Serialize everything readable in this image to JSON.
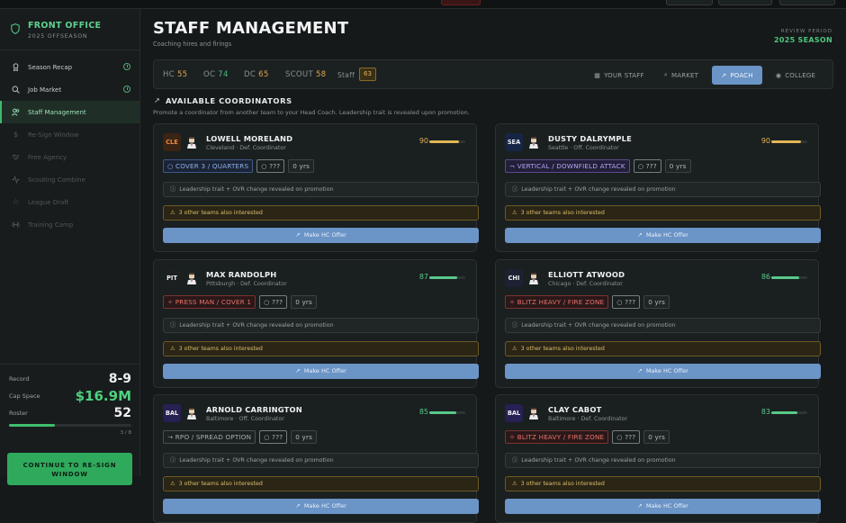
{
  "sidebar": {
    "title": "FRONT OFFICE",
    "subtitle": "2025 OFFSEASON",
    "items": [
      {
        "label": "Season Recap",
        "icon": "award-icon",
        "state": "done"
      },
      {
        "label": "Job Market",
        "icon": "search-icon",
        "state": "done"
      },
      {
        "label": "Staff Management",
        "icon": "users-icon",
        "state": "active"
      },
      {
        "label": "Re-Sign Window",
        "icon": "dollar-icon",
        "state": "locked"
      },
      {
        "label": "Free Agency",
        "icon": "handshake-icon",
        "state": "locked"
      },
      {
        "label": "Scouting Combine",
        "icon": "activity-icon",
        "state": "locked"
      },
      {
        "label": "League Draft",
        "icon": "star-icon",
        "state": "locked"
      },
      {
        "label": "Training Camp",
        "icon": "dumbbell-icon",
        "state": "locked"
      }
    ],
    "stats": {
      "record_label": "Record",
      "record": "8-9",
      "cap_label": "Cap Space",
      "cap": "$16.9M",
      "roster_label": "Roster",
      "roster": "52",
      "progress_text": "3 / 8",
      "progress_fraction": 0.375
    },
    "continue_label": "CONTINUE TO RE-SIGN WINDOW"
  },
  "header": {
    "title": "STAFF MANAGEMENT",
    "subtitle": "Coaching hires and firings",
    "review_label": "REVIEW PERIOD",
    "review_value": "2025 SEASON"
  },
  "counts": {
    "hc_label": "HC",
    "hc": "55",
    "oc_label": "OC",
    "oc": "74",
    "dc_label": "DC",
    "dc": "65",
    "scout_label": "SCOUT",
    "scout": "58",
    "staff_label": "Staff",
    "staff": "63"
  },
  "tabs": [
    {
      "label": "YOUR STAFF",
      "icon": "building-icon"
    },
    {
      "label": "MARKET",
      "icon": "search-icon"
    },
    {
      "label": "POACH",
      "icon": "arrow-up-right-icon",
      "active": true
    },
    {
      "label": "COLLEGE",
      "icon": "eye-icon"
    }
  ],
  "section": {
    "title": "AVAILABLE COORDINATORS",
    "subtitle": "Promote a coordinator from another team to your Head Coach. Leadership trait is revealed upon promotion."
  },
  "colors": {
    "accent_green": "#4fd07f",
    "accent_blue": "#6b94c7",
    "gold": "#e1b656"
  },
  "coordinators": [
    {
      "team": "CLE",
      "team_color": "#3a2414",
      "team_text": "#f08a3a",
      "name": "LOWELL MORELAND",
      "location": "Cleveland · Def. Coordinator",
      "ovr": "90",
      "ovr_value": 90,
      "ovr_color": "gold",
      "scheme": "COVER 3 / QUARTERS",
      "scheme_style": "blue",
      "scheme_icon": "○",
      "trait": "○ ???",
      "experience": "0 yrs",
      "leadership_note": "Leadership trait + OVR change revealed on promotion",
      "interest_note": "3 other teams also interested",
      "offer_label": "Make HC Offer"
    },
    {
      "team": "SEA",
      "team_color": "#172544",
      "team_text": "#eaf0f7",
      "name": "DUSTY DALRYMPLE",
      "location": "Seattle · Off. Coordinator",
      "ovr": "90",
      "ovr_value": 90,
      "ovr_color": "gold",
      "scheme": "VERTICAL / DOWNFIELD ATTACK",
      "scheme_style": "purple",
      "scheme_icon": "¬",
      "trait": "○ ???",
      "experience": "0 yrs",
      "leadership_note": "Leadership trait + OVR change revealed on promotion",
      "interest_note": "3 other teams also interested",
      "offer_label": "Make HC Offer"
    },
    {
      "team": "PIT",
      "team_color": "#1d2021",
      "team_text": "#f2f2f2",
      "name": "MAX RANDOLPH",
      "location": "Pittsburgh · Def. Coordinator",
      "ovr": "87",
      "ovr_value": 87,
      "ovr_color": "green",
      "scheme": "PRESS MAN / COVER 1",
      "scheme_style": "red",
      "scheme_icon": "✧",
      "trait": "○ ???",
      "experience": "0 yrs",
      "leadership_note": "Leadership trait + OVR change revealed on promotion",
      "interest_note": "3 other teams also interested",
      "offer_label": "Make HC Offer"
    },
    {
      "team": "CHI",
      "team_color": "#1c2233",
      "team_text": "#f2f2f2",
      "name": "ELLIOTT ATWOOD",
      "location": "Chicago · Def. Coordinator",
      "ovr": "86",
      "ovr_value": 86,
      "ovr_color": "green",
      "scheme": "BLITZ HEAVY / FIRE ZONE",
      "scheme_style": "red",
      "scheme_icon": "✧",
      "trait": "○ ???",
      "experience": "0 yrs",
      "leadership_note": "Leadership trait + OVR change revealed on promotion",
      "interest_note": "3 other teams also interested",
      "offer_label": "Make HC Offer"
    },
    {
      "team": "BAL",
      "team_color": "#262053",
      "team_text": "#f2f2f2",
      "name": "ARNOLD CARRINGTON",
      "location": "Baltimore · Off. Coordinator",
      "ovr": "85",
      "ovr_value": 85,
      "ovr_color": "green",
      "scheme": "RPO / SPREAD OPTION",
      "scheme_style": "gray",
      "scheme_icon": "→",
      "trait": "○ ???",
      "experience": "0 yrs",
      "leadership_note": "Leadership trait + OVR change revealed on promotion",
      "interest_note": "3 other teams also interested",
      "offer_label": "Make HC Offer"
    },
    {
      "team": "BAL",
      "team_color": "#262053",
      "team_text": "#f2f2f2",
      "name": "CLAY CABOT",
      "location": "Baltimore · Def. Coordinator",
      "ovr": "83",
      "ovr_value": 83,
      "ovr_color": "green",
      "scheme": "BLITZ HEAVY / FIRE ZONE",
      "scheme_style": "red",
      "scheme_icon": "✧",
      "trait": "○ ???",
      "experience": "0 yrs",
      "leadership_note": "Leadership trait + OVR change revealed on promotion",
      "interest_note": "3 other teams also interested",
      "offer_label": "Make HC Offer"
    }
  ]
}
